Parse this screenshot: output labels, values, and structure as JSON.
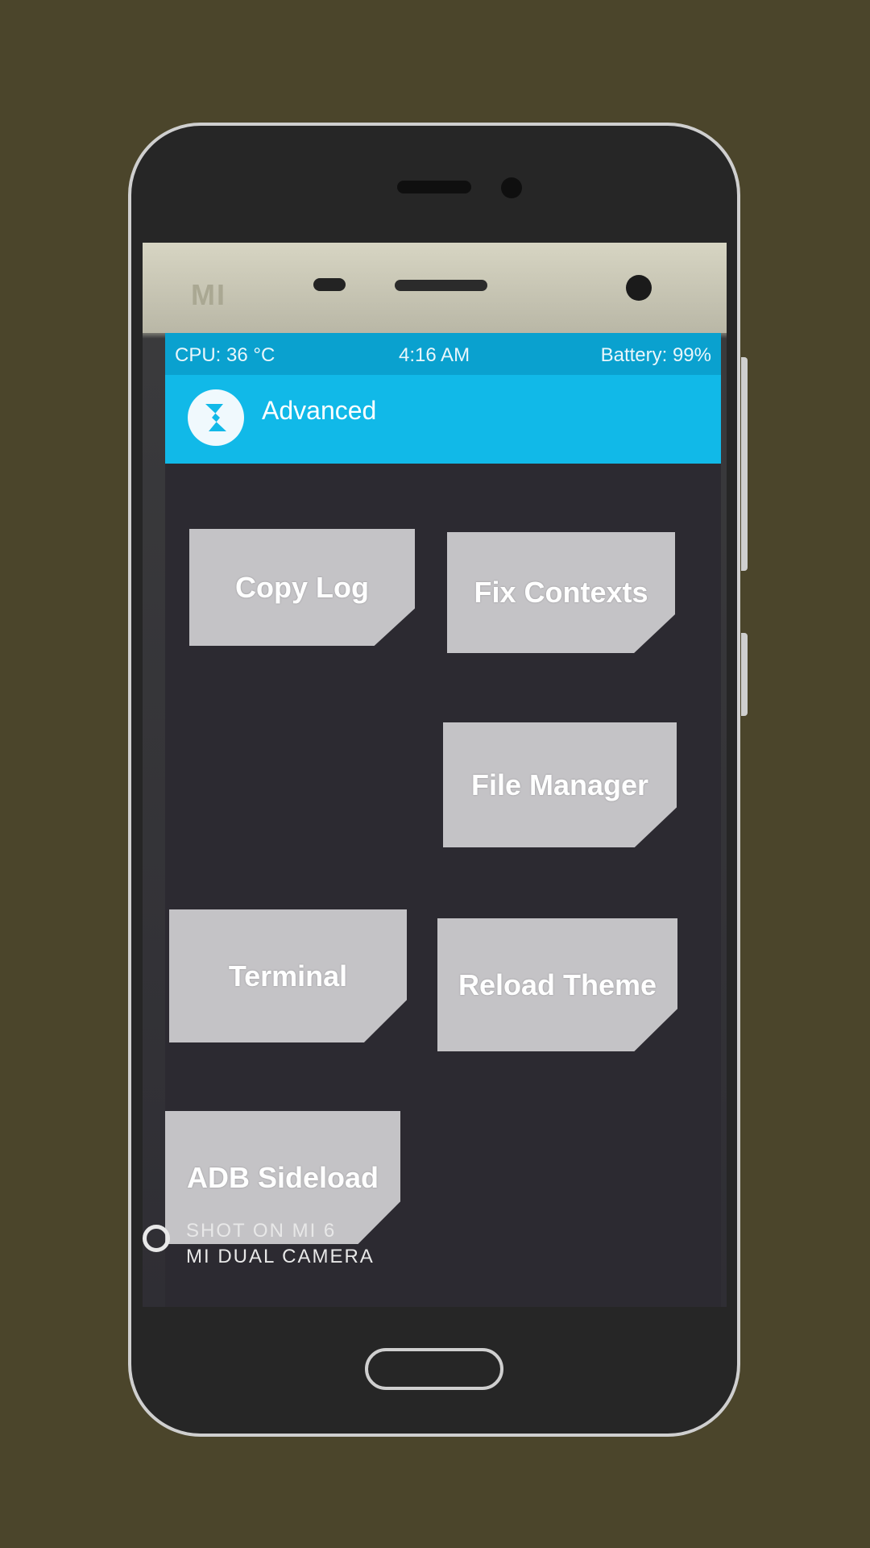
{
  "status": {
    "cpu": "CPU: 36 °C",
    "time": "4:16 AM",
    "battery": "Battery: 99%"
  },
  "header": {
    "title": "Advanced",
    "logo_icon": "twrp-logo-icon"
  },
  "device": {
    "brand": "MI"
  },
  "buttons": {
    "copy_log": "Copy Log",
    "fix_contexts": "Fix Contexts",
    "file_manager": "File Manager",
    "terminal": "Terminal",
    "reload_theme": "Reload Theme",
    "adb_sideload": "ADB Sideload"
  },
  "watermark": {
    "line1": "SHOT ON MI 6",
    "line2": "MI DUAL CAMERA"
  },
  "colors": {
    "background": "#4b452b",
    "accent": "#11b9e8",
    "button": "#c4c3c6"
  }
}
